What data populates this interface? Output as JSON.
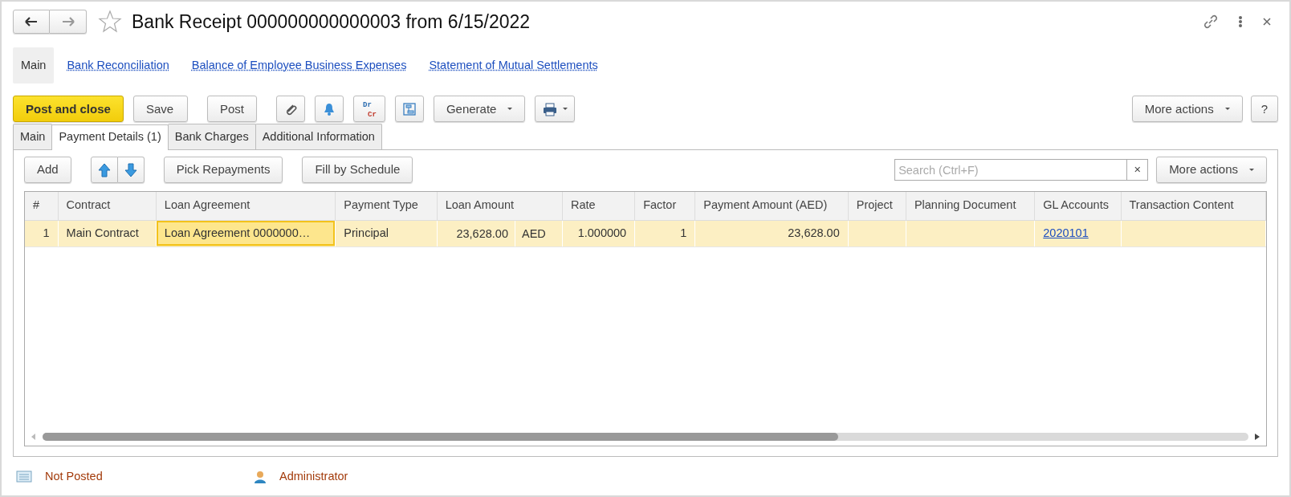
{
  "window": {
    "title": "Bank Receipt 000000000000003 from 6/15/2022",
    "favorite": false
  },
  "nav": [
    {
      "label": "Main",
      "selected": true
    },
    {
      "label": "Bank Reconciliation",
      "selected": false
    },
    {
      "label": "Balance of Employee Business Expenses",
      "selected": false
    },
    {
      "label": "Statement of Mutual Settlements",
      "selected": false
    }
  ],
  "toolbar": [
    {
      "kind": "primary",
      "label": "Post and close"
    },
    {
      "kind": "text",
      "label": "Save"
    },
    {
      "kind": "text",
      "label": "Post"
    },
    {
      "kind": "icon"
    },
    {
      "kind": "icon"
    },
    {
      "kind": "icon",
      "lines": [
        "Dr",
        "Cr"
      ]
    },
    {
      "kind": "icon"
    },
    {
      "kind": "dropdown",
      "label": "Generate"
    },
    {
      "kind": "icon-dropdown"
    }
  ],
  "toolbar_right": [
    {
      "kind": "dropdown",
      "label": "More actions"
    },
    {
      "kind": "text",
      "label": "?"
    }
  ],
  "tabs": [
    {
      "label": "Main",
      "selected": false
    },
    {
      "label": "Payment Details (1)",
      "selected": true
    },
    {
      "label": "Bank Charges",
      "selected": false
    },
    {
      "label": "Additional Information",
      "selected": false
    }
  ],
  "table_toolbar": {
    "buttons": [
      {
        "kind": "text",
        "label": "Add"
      },
      {
        "kind": "arrows"
      },
      {
        "kind": "text",
        "label": "Pick Repayments"
      },
      {
        "kind": "text",
        "label": "Fill by Schedule"
      }
    ],
    "search": {
      "placeholder": "Search (Ctrl+F)",
      "clear": "×"
    },
    "more": {
      "label": "More actions"
    }
  },
  "table": {
    "columns": [
      {
        "label": "#"
      },
      {
        "label": "Contract"
      },
      {
        "label": "Loan Agreement"
      },
      {
        "label": "Payment Type"
      },
      {
        "label": "Loan Amount"
      },
      {
        "label": "Rate"
      },
      {
        "label": "Factor"
      },
      {
        "label": "Payment Amount (AED)"
      },
      {
        "label": "Project"
      },
      {
        "label": "Planning Document"
      },
      {
        "label": "GL Accounts"
      },
      {
        "label": "Transaction Content"
      }
    ],
    "rows": [
      {
        "selected": true,
        "cells": [
          {
            "kind": "number",
            "text": "1",
            "focused": false
          },
          {
            "kind": "text",
            "text": "Main Contract",
            "focused": false
          },
          {
            "kind": "text",
            "text": "Loan Agreement 0000000…",
            "focused": true
          },
          {
            "kind": "text",
            "text": "Principal",
            "focused": false
          },
          {
            "kind": "amount",
            "text": "23,628.00",
            "currency": "AED",
            "focused": false
          },
          {
            "kind": "number",
            "text": "1.000000",
            "focused": false
          },
          {
            "kind": "number",
            "text": "1",
            "focused": false
          },
          {
            "kind": "number",
            "text": "23,628.00",
            "focused": false
          },
          {
            "kind": "empty"
          },
          {
            "kind": "empty"
          },
          {
            "kind": "link",
            "text": "2020101",
            "focused": false
          },
          {
            "kind": "empty"
          }
        ]
      }
    ]
  },
  "status": [
    {
      "text": "Not Posted"
    },
    {
      "text": "Administrator"
    }
  ]
}
